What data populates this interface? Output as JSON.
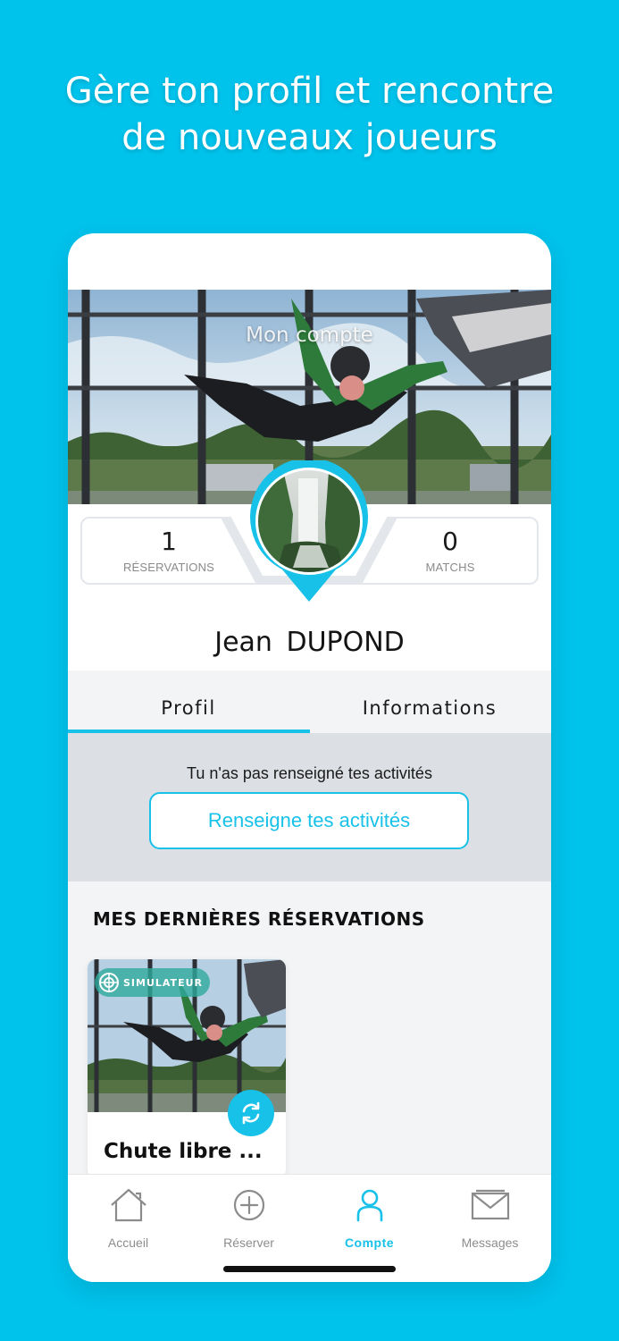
{
  "headline": {
    "line1": "Gère ton profil et rencontre",
    "line2": "de nouveaux joueurs"
  },
  "header": {
    "title": "Mon compte"
  },
  "stats": {
    "reservations": {
      "value": "1",
      "label": "RÉSERVATIONS"
    },
    "matchs": {
      "value": "0",
      "label": "MATCHS"
    }
  },
  "profile": {
    "first_name": "Jean",
    "last_name": "DUPOND"
  },
  "tabs": [
    {
      "label": "Profil",
      "active": true
    },
    {
      "label": "Informations",
      "active": false
    }
  ],
  "activities": {
    "message": "Tu n'as pas renseigné tes activités",
    "button_label": "Renseigne tes activités"
  },
  "recent": {
    "title": "MES DERNIÈRES RÉSERVATIONS",
    "items": [
      {
        "badge": "SIMULATEUR",
        "title": "Chute libre ..."
      }
    ]
  },
  "tabbar": {
    "items": [
      {
        "label": "Accueil",
        "icon": "home-icon"
      },
      {
        "label": "Réserver",
        "icon": "plus-circle-icon"
      },
      {
        "label": "Compte",
        "icon": "user-icon",
        "active": true
      },
      {
        "label": "Messages",
        "icon": "mail-icon"
      }
    ]
  },
  "colors": {
    "background": "#00c3ec",
    "accent": "#17c1e8",
    "badge": "#2eaa9e"
  }
}
